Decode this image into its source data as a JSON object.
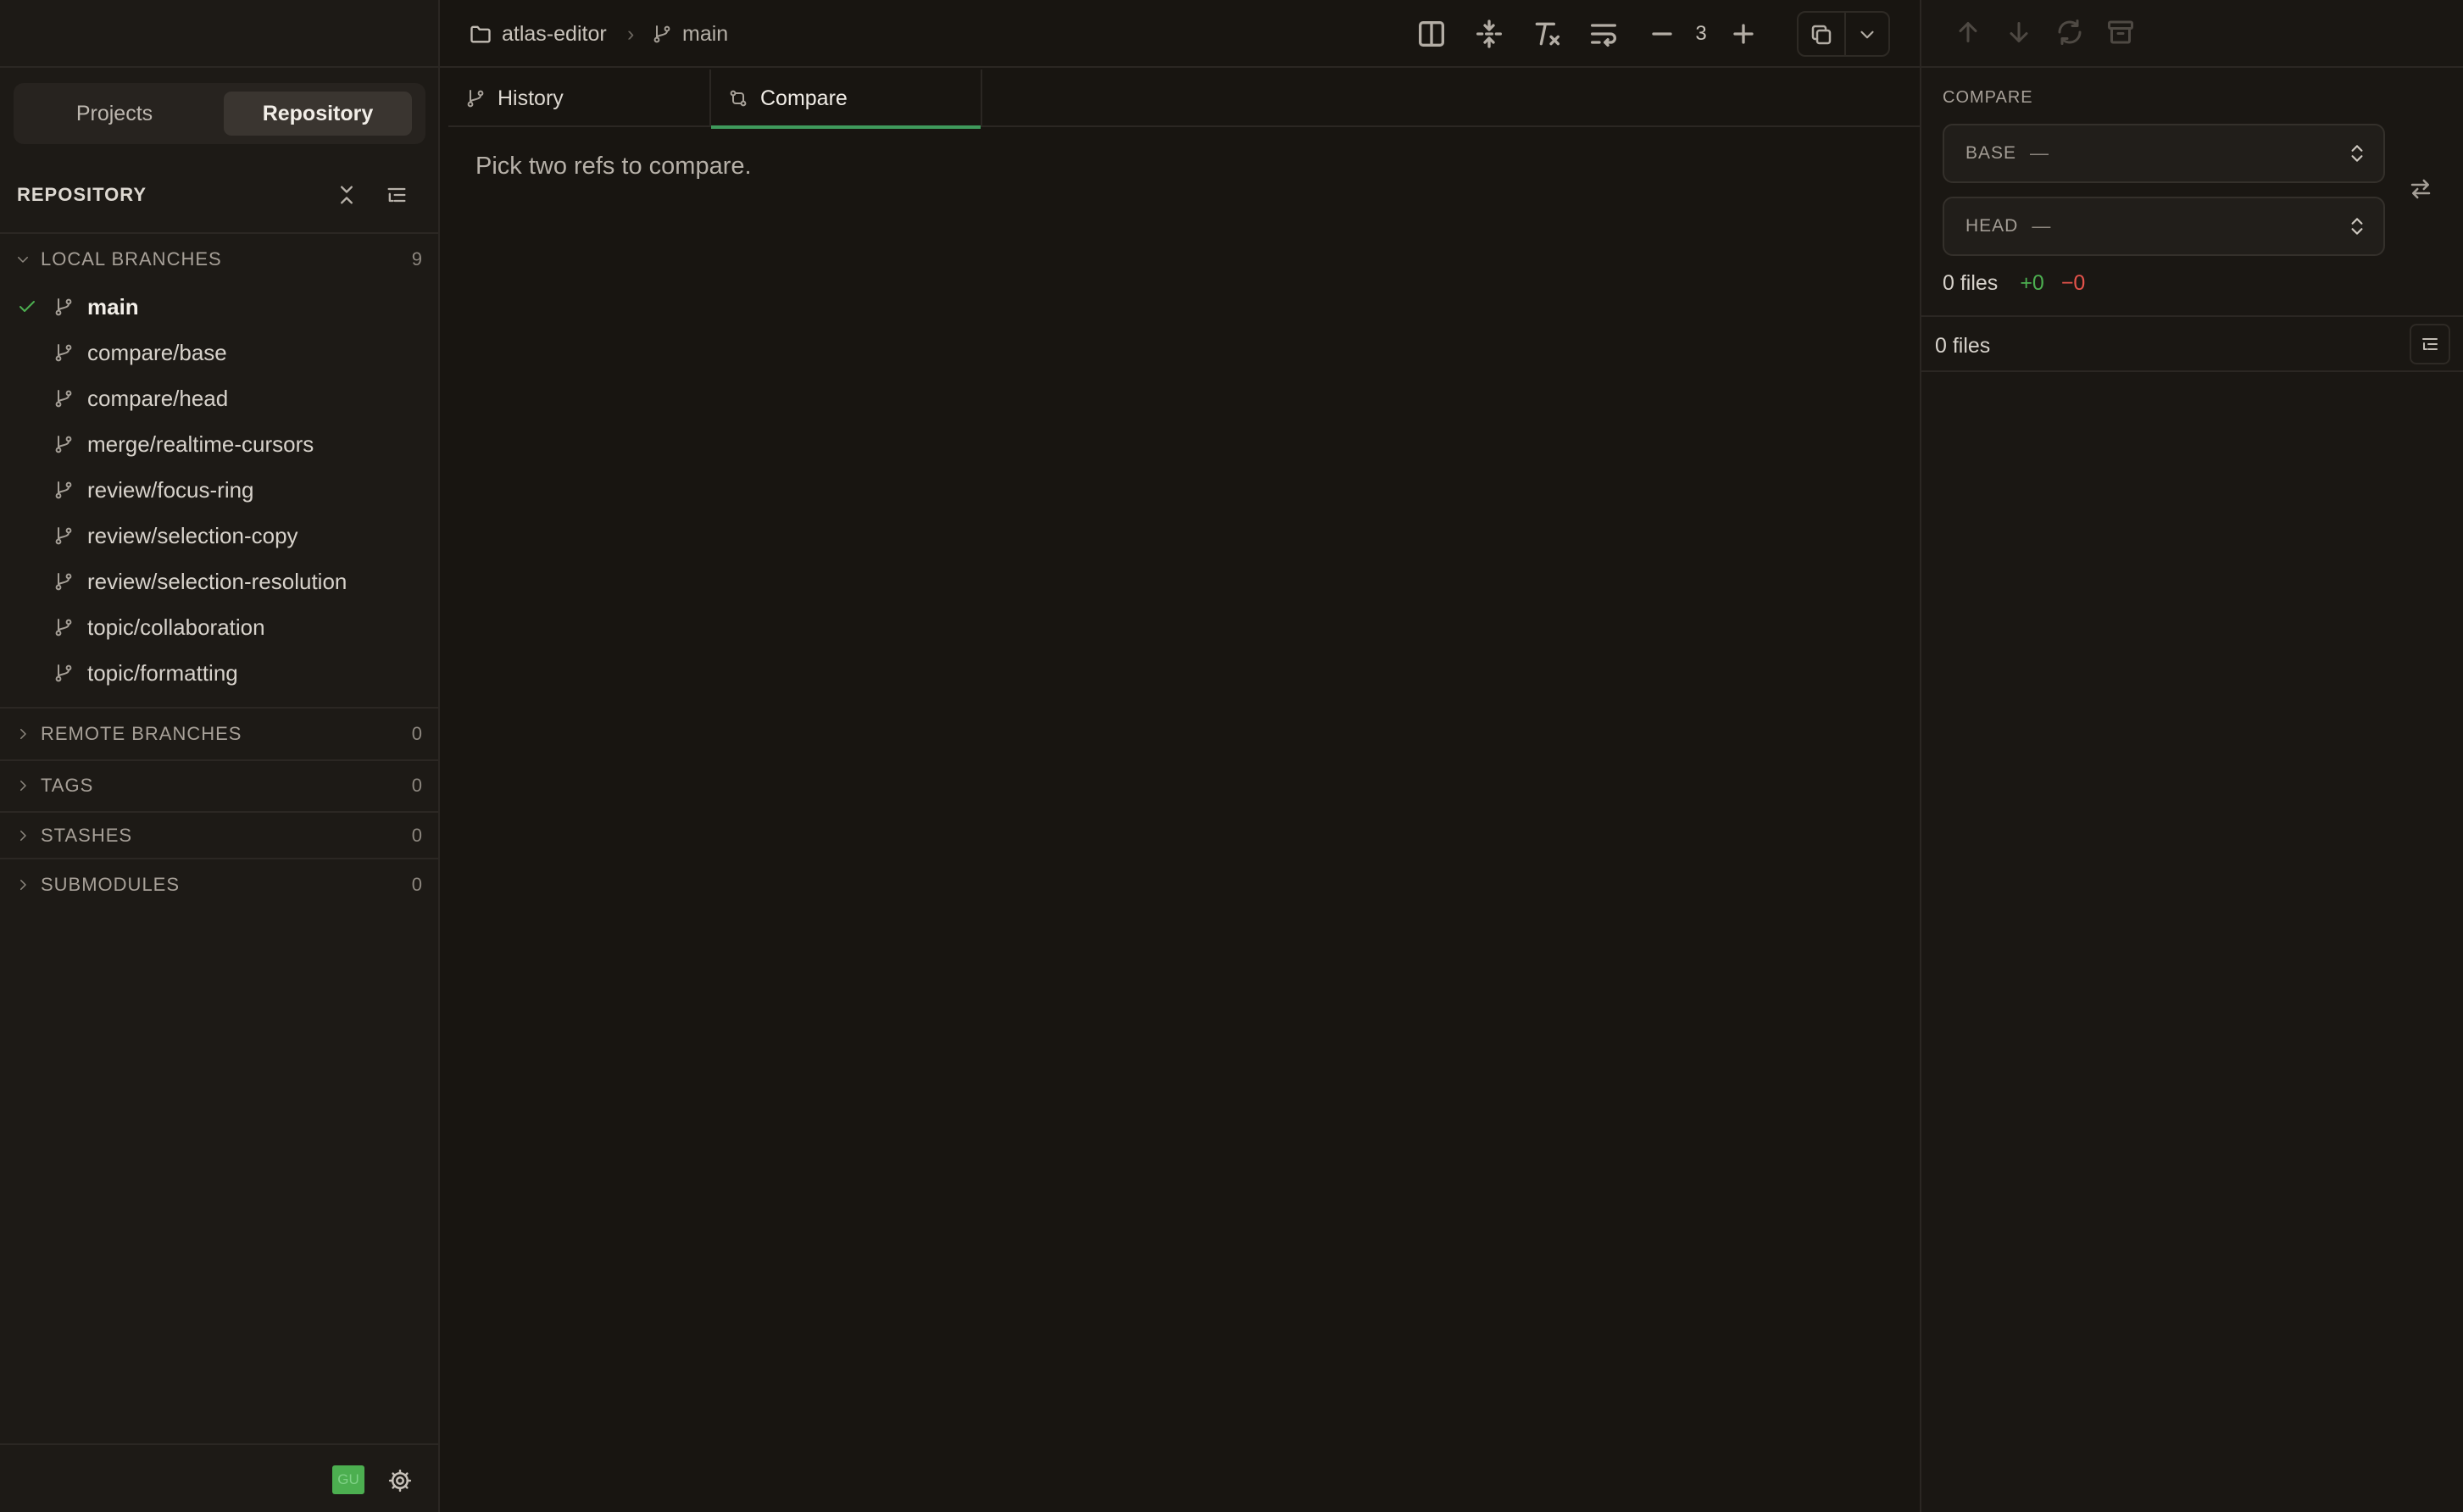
{
  "sidebar": {
    "segments": [
      "Projects",
      "Repository"
    ],
    "active_segment": "Repository",
    "section_title": "REPOSITORY",
    "local_branches": {
      "label": "LOCAL BRANCHES",
      "count": "9",
      "items": [
        {
          "name": "main",
          "current": true
        },
        {
          "name": "compare/base",
          "current": false
        },
        {
          "name": "compare/head",
          "current": false
        },
        {
          "name": "merge/realtime-cursors",
          "current": false
        },
        {
          "name": "review/focus-ring",
          "current": false
        },
        {
          "name": "review/selection-copy",
          "current": false
        },
        {
          "name": "review/selection-resolution",
          "current": false
        },
        {
          "name": "topic/collaboration",
          "current": false
        },
        {
          "name": "topic/formatting",
          "current": false
        }
      ]
    },
    "sections": [
      {
        "label": "REMOTE BRANCHES",
        "count": "0"
      },
      {
        "label": "TAGS",
        "count": "0"
      },
      {
        "label": "STASHES",
        "count": "0"
      },
      {
        "label": "SUBMODULES",
        "count": "0"
      }
    ],
    "avatar_text": "GU",
    "avatar_color": "#4caf50"
  },
  "header": {
    "project": "atlas-editor",
    "branch": "main",
    "context_lines": "3",
    "icons": [
      "split-view-icon",
      "expand-lines-icon",
      "clear-format-icon",
      "wrap-icon",
      "minus-icon",
      "plus-icon",
      "copy-icon",
      "chevron-down-icon"
    ]
  },
  "tabs": [
    {
      "label": "History",
      "icon": "branch-icon",
      "active": false
    },
    {
      "label": "Compare",
      "icon": "compare-icon",
      "active": true
    }
  ],
  "main": {
    "placeholder": "Pick two refs to compare."
  },
  "compare_panel": {
    "title": "COMPARE",
    "base_label": "BASE",
    "base_value": "—",
    "head_label": "HEAD",
    "head_value": "—",
    "summary_files": "0 files",
    "additions": "+0",
    "deletions": "−0",
    "list_header": "0 files",
    "colors": {
      "additions": "#4caf50",
      "deletions": "#e5534b",
      "accent": "#3f9a5c"
    }
  }
}
